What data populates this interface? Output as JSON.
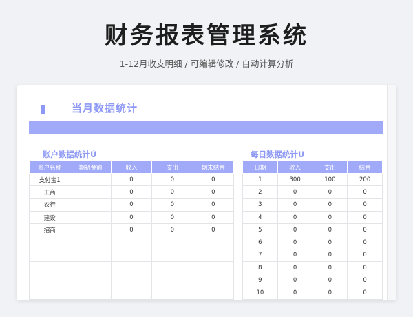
{
  "header": {
    "title": "财务报表管理系统",
    "subtitle": "1-12月收支明细 /  可编辑修改  / 自动计算分析"
  },
  "sheet": {
    "title": "当月数据统计"
  },
  "accounts": {
    "title": "账户数据统计Ú",
    "columns": [
      "账户名称",
      "期初金额",
      "收入",
      "支出",
      "期末结余"
    ],
    "rows": [
      [
        "支付宝1",
        "",
        "0",
        "0",
        "0"
      ],
      [
        "工商",
        "",
        "0",
        "0",
        "0"
      ],
      [
        "农行",
        "",
        "0",
        "0",
        "0"
      ],
      [
        "建设",
        "",
        "0",
        "0",
        "0"
      ],
      [
        "招商",
        "",
        "0",
        "0",
        "0"
      ],
      [
        "",
        "",
        "",
        "",
        ""
      ],
      [
        "",
        "",
        "",
        "",
        ""
      ],
      [
        "",
        "",
        "",
        "",
        ""
      ],
      [
        "",
        "",
        "",
        "",
        ""
      ],
      [
        "",
        "",
        "",
        "",
        ""
      ]
    ]
  },
  "daily": {
    "title": "每日数据统计Ú",
    "columns": [
      "日期",
      "收入",
      "支出",
      "结余"
    ],
    "rows": [
      [
        "1",
        "300",
        "100",
        "200"
      ],
      [
        "2",
        "0",
        "0",
        "0"
      ],
      [
        "3",
        "0",
        "0",
        "0"
      ],
      [
        "4",
        "0",
        "0",
        "0"
      ],
      [
        "5",
        "0",
        "0",
        "0"
      ],
      [
        "6",
        "0",
        "0",
        "0"
      ],
      [
        "7",
        "0",
        "0",
        "0"
      ],
      [
        "8",
        "0",
        "0",
        "0"
      ],
      [
        "9",
        "0",
        "0",
        "0"
      ],
      [
        "10",
        "0",
        "0",
        "0"
      ]
    ]
  },
  "colors": {
    "accent": "#8d99f5",
    "header_fill": "#a1aaf8",
    "background": "#f1f2f6"
  }
}
